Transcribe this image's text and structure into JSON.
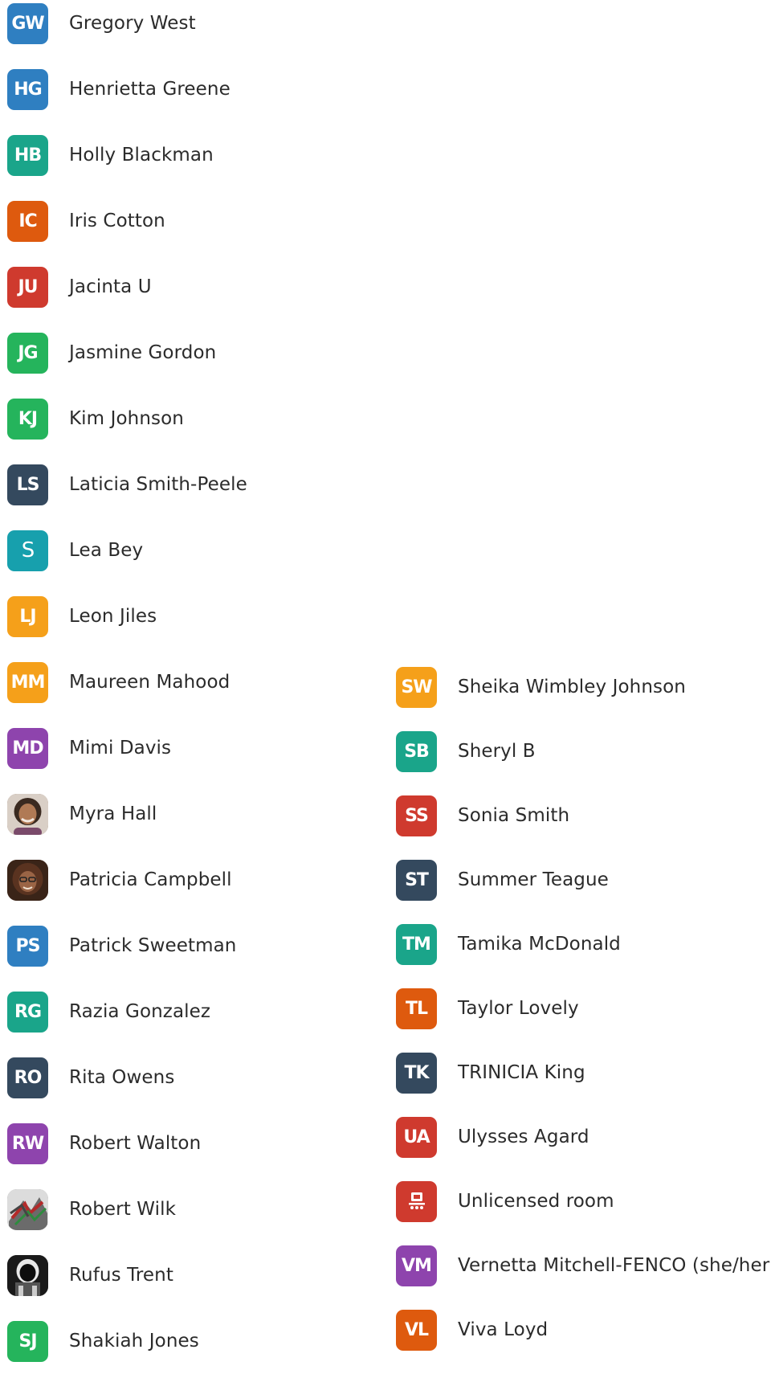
{
  "participants_left": [
    {
      "initials": "GW",
      "name": "Gregory West",
      "color": "#2f7fc1"
    },
    {
      "initials": "HG",
      "name": "Henrietta Greene",
      "color": "#2f7fc1"
    },
    {
      "initials": "HB",
      "name": "Holly Blackman",
      "color": "#1aa58a"
    },
    {
      "initials": "IC",
      "name": "Iris Cotton",
      "color": "#de5a0e"
    },
    {
      "initials": "JU",
      "name": "Jacinta U",
      "color": "#cf3a2e"
    },
    {
      "initials": "JG",
      "name": "Jasmine Gordon",
      "color": "#25b45c"
    },
    {
      "initials": "KJ",
      "name": "Kim Johnson",
      "color": "#25b45c"
    },
    {
      "initials": "LS",
      "name": "Laticia Smith-Peele",
      "color": "#34495e"
    },
    {
      "initials": "S",
      "name": "Lea Bey",
      "color": "#17a0ad"
    },
    {
      "initials": "LJ",
      "name": "Leon Jiles",
      "color": "#f5a01a"
    },
    {
      "initials": "MM",
      "name": "Maureen Mahood",
      "color": "#f5a01a"
    },
    {
      "initials": "MD",
      "name": "Mimi Davis",
      "color": "#8e44ad"
    },
    {
      "initials": "",
      "name": "Myra Hall",
      "color": "#8a6a55",
      "photo": "photo-1"
    },
    {
      "initials": "",
      "name": "Patricia Campbell",
      "color": "#5a3a2a",
      "photo": "photo-2"
    },
    {
      "initials": "PS",
      "name": "Patrick Sweetman",
      "color": "#2f7fc1"
    },
    {
      "initials": "RG",
      "name": "Razia Gonzalez",
      "color": "#1aa58a"
    },
    {
      "initials": "RO",
      "name": "Rita Owens",
      "color": "#34495e"
    },
    {
      "initials": "RW",
      "name": "Robert Walton",
      "color": "#8e44ad"
    },
    {
      "initials": "",
      "name": "Robert Wilk",
      "color": "#888888",
      "photo": "photo-3"
    },
    {
      "initials": "",
      "name": "Rufus Trent",
      "color": "#222222",
      "photo": "photo-4"
    },
    {
      "initials": "SJ",
      "name": "Shakiah Jones",
      "color": "#25b45c"
    }
  ],
  "participants_right": [
    {
      "initials": "SW",
      "name": "Sheika Wimbley Johnson",
      "color": "#f5a01a"
    },
    {
      "initials": "SB",
      "name": "Sheryl B",
      "color": "#1aa58a"
    },
    {
      "initials": "SS",
      "name": "Sonia Smith",
      "color": "#cf3a2e"
    },
    {
      "initials": "ST",
      "name": "Summer Teague",
      "color": "#34495e"
    },
    {
      "initials": "TM",
      "name": "Tamika McDonald",
      "color": "#1aa58a"
    },
    {
      "initials": "TL",
      "name": "Taylor Lovely",
      "color": "#de5a0e"
    },
    {
      "initials": "TK",
      "name": "TRINICIA King",
      "color": "#34495e"
    },
    {
      "initials": "UA",
      "name": "Ulysses Agard",
      "color": "#cf3a2e"
    },
    {
      "initials": "",
      "name": "Unlicensed room",
      "color": "#cf3a2e",
      "icon": "room-icon"
    },
    {
      "initials": "VM",
      "name": "Vernetta Mitchell-FENCO (she/her)",
      "color": "#8e44ad"
    },
    {
      "initials": "VL",
      "name": "Viva Loyd",
      "color": "#de5a0e"
    }
  ]
}
